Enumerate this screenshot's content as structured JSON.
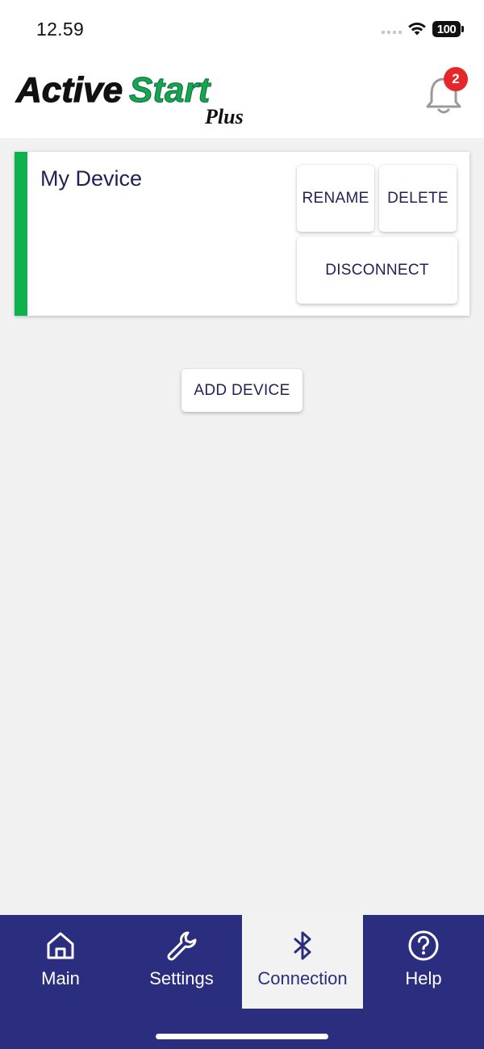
{
  "status_bar": {
    "time": "12.59",
    "battery": "100"
  },
  "header": {
    "logo_text_primary": "Active",
    "logo_text_secondary": "Start",
    "logo_text_sub": "Plus",
    "notification_count": "2"
  },
  "device_card": {
    "name": "My Device",
    "accent_color": "#0fb14e",
    "rename_label": "RENAME",
    "delete_label": "DELETE",
    "disconnect_label": "DISCONNECT"
  },
  "add_device_label": "ADD DEVICE",
  "tabs": [
    {
      "label": "Main",
      "icon": "home-icon",
      "active": false
    },
    {
      "label": "Settings",
      "icon": "wrench-icon",
      "active": false
    },
    {
      "label": "Connection",
      "icon": "bluetooth-icon",
      "active": true
    },
    {
      "label": "Help",
      "icon": "help-icon",
      "active": false
    }
  ],
  "colors": {
    "navy": "#2b2d7e",
    "text_dark": "#1f2157",
    "badge_red": "#e5272c",
    "accent_green": "#0fb14e"
  }
}
